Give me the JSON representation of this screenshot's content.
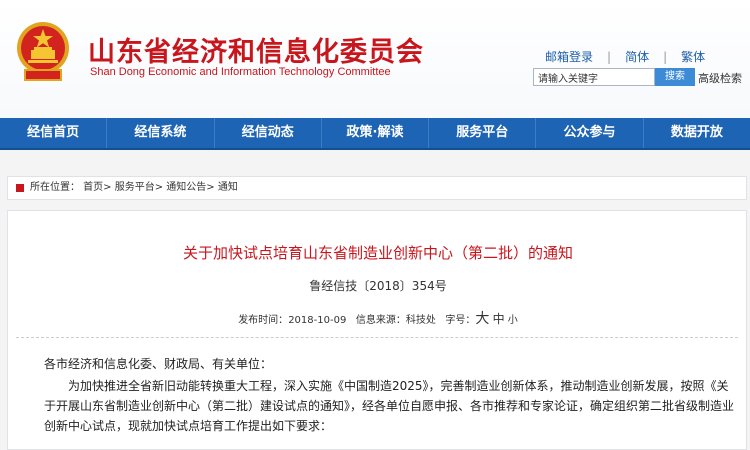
{
  "header": {
    "title": "山东省经济和信息化委员会",
    "subtitle": "Shan Dong Economic and Information Technology Committee",
    "links": [
      "邮箱登录",
      "简体",
      "繁体"
    ],
    "search_placeholder": "请输入关键字",
    "search_button": "搜索",
    "advanced_search": "高级检索"
  },
  "nav": [
    "经信首页",
    "经信系统",
    "经信动态",
    "政策·解读",
    "服务平台",
    "公众参与",
    "数据开放"
  ],
  "breadcrumb": "所在位置： 首页> 服务平台> 通知公告> 通知",
  "article": {
    "title": "关于加快试点培育山东省制造业创新中心（第二批）的通知",
    "doc_number": "鲁经信技〔2018〕354号",
    "publish_label": "发布时间：",
    "publish_date": "2018-10-09",
    "source_label": "信息来源：",
    "source": "科技处",
    "fontsize_label": "字号：",
    "size_large": "大",
    "size_medium": "中",
    "size_small": "小",
    "salutation": "各市经济和信息化委、财政局、有关单位：",
    "body": "为加快推进全省新旧动能转换重大工程，深入实施《中国制造2025》，完善制造业创新体系，推动制造业创新发展，按照《关于开展山东省制造业创新中心（第二批）建设试点的通知》，经各单位自愿申报、各市推荐和专家论证，确定组织第二批省级制造业创新中心试点，现就加快试点培育工作提出如下要求："
  },
  "colors": {
    "brand_red": "#c8161d",
    "nav_blue": "#1e64b4"
  }
}
